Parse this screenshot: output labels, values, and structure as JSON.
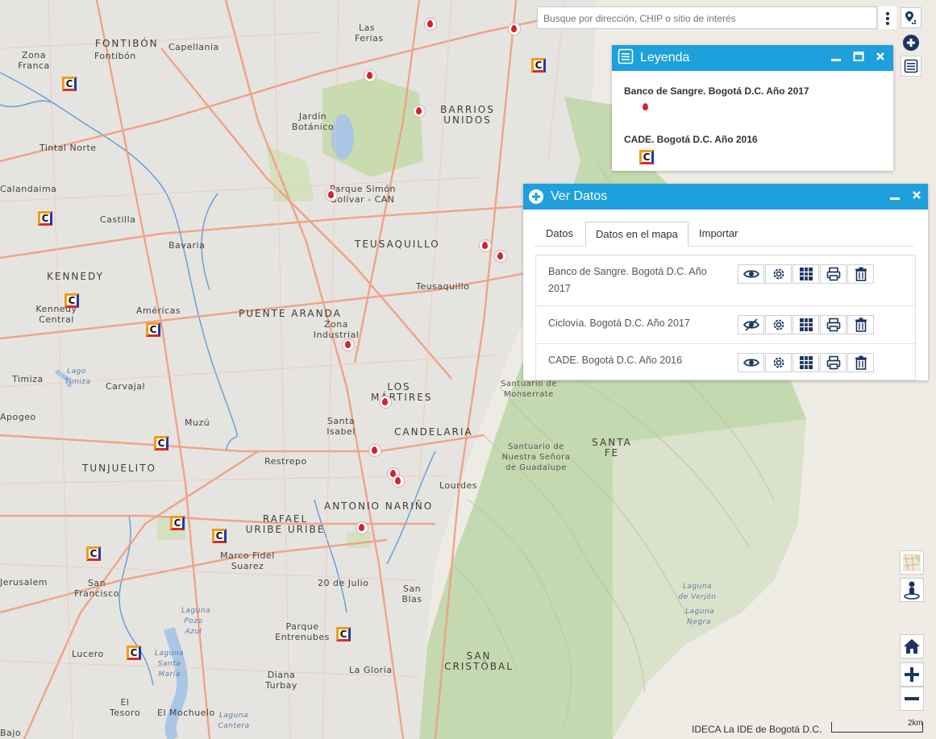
{
  "search": {
    "placeholder": "Busque por dirección, CHIP o sitio de interés"
  },
  "legend": {
    "title": "Leyenda",
    "layers": [
      {
        "name": "Banco de Sangre. Bogotá D.C. Año 2017",
        "icon": "blood-drop-icon"
      },
      {
        "name": "CADE. Bogotá D.C. Año 2016",
        "icon": "cade-icon"
      }
    ]
  },
  "ver_datos": {
    "title": "Ver Datos",
    "tabs": [
      "Datos",
      "Datos en el mapa",
      "Importar"
    ],
    "active_tab": "Datos en el mapa",
    "rows": [
      {
        "name": "Banco de Sangre. Bogotá D.C. Año 2017",
        "visible": true
      },
      {
        "name": "Ciclovía. Bogotá D.C. Año 2017",
        "visible": false
      },
      {
        "name": "CADE. Bogotá D.C. Año 2016",
        "visible": true
      }
    ]
  },
  "attribution": "IDECA La IDE de Bogotá D.C.",
  "scale_label": "2km",
  "colors": {
    "header_blue": "#1ea0dc",
    "icon_navy": "#1c3560",
    "blood_red": "#d6202b"
  },
  "map_labels": {
    "fontibon": "FONTIBÓN",
    "fontibon_small": "Fontibón",
    "capellania": "Capellania",
    "zona_franca": "Zona Franca",
    "las_ferias": "Las Ferias",
    "barrios_unidos": "BARRIOS UNIDOS",
    "jardin_botanico": "Jardín Botánico",
    "tintal_norte": "Tintal Norte",
    "calandaima": "Calandaima",
    "castilla": "Castilla",
    "parque_simon_bolivar": "Parque Simón Bolívar - CAN",
    "bavaria": "Bavaria",
    "teusaquillo_big": "TEUSAQUILLO",
    "kennedy": "KENNEDY",
    "teusaquillo": "Teusaquillo",
    "kennedy_central": "Kennedy Central",
    "americas": "Américas",
    "puente_aranda": "PUENTE ARANDA",
    "zona_industrial": "Zona Industrial",
    "timiza": "Timiza",
    "carvajal": "Carvajal",
    "los_martires": "LOS MÁRTIRES",
    "santuario_monserrate": "Santuario de Monserrate",
    "apogeo": "Apogeo",
    "muzu": "Muzú",
    "santa_isabel": "Santa Isabel",
    "candelaria": "CANDELARIA",
    "santa_fe": "SANTA FE",
    "santuario_guadalupe": "Santuario de Nuestra Señora de Guadalupe",
    "tunjuelito": "TUNJUELITO",
    "restrepo": "Restrepo",
    "lourdes": "Lourdes",
    "antonio_narino": "ANTONIO NARIÑO",
    "rafael_uribe": "RAFAEL URIBE URIBE",
    "marco_fidel_suarez": "Marco Fidel Suarez",
    "san_francisco": "San Francisco",
    "veinte_de_julio": "20 de Julio",
    "san_blas": "San Blas",
    "jerusalem": "Jerusalem",
    "laguna_pozo_azul": "Laguna Pozo Azul",
    "parque_entrenubes": "Parque Entrenubes",
    "lucero": "Lucero",
    "laguna_santa_maria": "Laguna Santa María",
    "san_cristobal": "SAN CRISTÓBAL",
    "diana_turbay": "Diana Turbay",
    "la_gloria": "La Gloria",
    "el_tesoro": "El Tesoro",
    "el_mochuelo": "El Mochuelo",
    "laguna_verjon": "Laguna de Verjón",
    "laguna_negra": "Laguna Negra",
    "lago_timiza": "Lago Timiza",
    "laguna_cantera": "Laguna Cantera",
    "bajo": "Bajo"
  }
}
